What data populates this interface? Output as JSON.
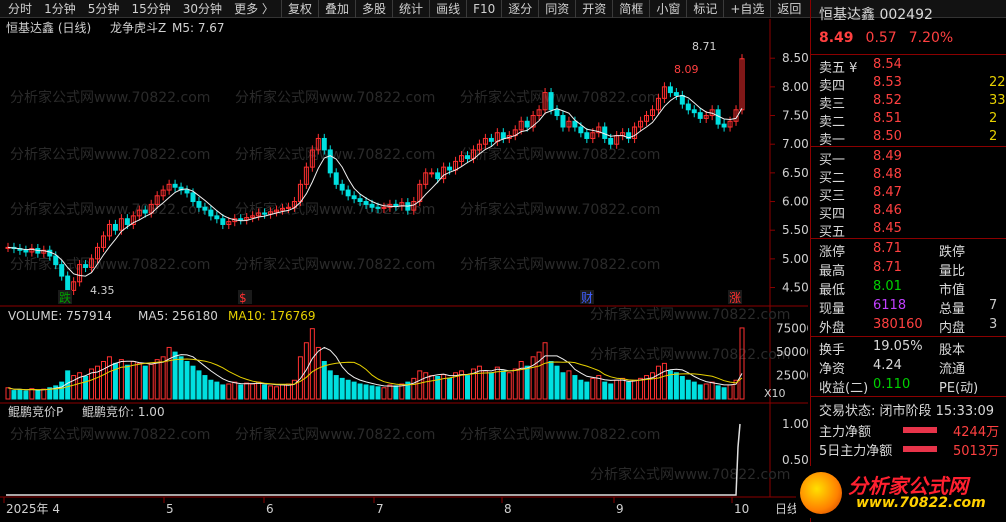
{
  "toolbar": {
    "periods": [
      "分时",
      "1分钟",
      "5分钟",
      "15分钟",
      "30分钟",
      "更多 〉"
    ],
    "buttons": [
      "复权",
      "叠加",
      "多股",
      "统计",
      "画线",
      "F10",
      "逐分",
      "同资",
      "开资",
      "简框",
      "小窗",
      "标记",
      "+自选",
      "返回"
    ]
  },
  "header": {
    "stock": "恒基达鑫 (日线)",
    "indicator": "龙争虎斗Z",
    "ma": "M5: 7.67"
  },
  "watermark": "分析家公式网www.70822.com",
  "price_axis": [
    "8.50",
    "8.00",
    "7.50",
    "7.00",
    "6.50",
    "6.00",
    "5.50",
    "5.00",
    "4.50"
  ],
  "price_labels": {
    "high": "8.71",
    "low": "4.35",
    "peak": "8.09"
  },
  "volume_header": {
    "vol": "VOLUME: 757914",
    "ma5": "MA5: 256180",
    "ma10": "MA10: 176769"
  },
  "volume_axis": [
    "75000",
    "50000",
    "25000"
  ],
  "volume_unit": "X10",
  "bottom_header": {
    "a": "鲲鹏竞价P",
    "b": "鲲鹏竞价: 1.00"
  },
  "bottom_axis": [
    "1.00",
    "0.50"
  ],
  "date_axis": [
    "2025年 4",
    "5",
    "6",
    "7",
    "8",
    "9",
    "10"
  ],
  "period_label": "日线",
  "event_tags": [
    "跌",
    "$",
    "财",
    "涨"
  ],
  "chart_data": {
    "type": "candlestick",
    "close": [
      5.2,
      5.18,
      5.15,
      5.12,
      5.18,
      5.1,
      5.15,
      5.05,
      4.9,
      4.7,
      4.45,
      4.6,
      4.9,
      4.85,
      5.0,
      5.2,
      5.4,
      5.6,
      5.5,
      5.7,
      5.6,
      5.75,
      5.85,
      5.8,
      5.95,
      6.1,
      6.2,
      6.3,
      6.25,
      6.2,
      6.15,
      6.0,
      5.9,
      5.85,
      5.75,
      5.7,
      5.6,
      5.65,
      5.7,
      5.68,
      5.72,
      5.75,
      5.8,
      5.78,
      5.82,
      5.85,
      5.88,
      5.9,
      6.0,
      6.3,
      6.6,
      6.9,
      7.1,
      6.9,
      6.5,
      6.3,
      6.2,
      6.1,
      6.05,
      6.0,
      5.95,
      5.9,
      5.88,
      5.9,
      5.95,
      5.92,
      5.98,
      5.85,
      6.0,
      6.3,
      6.5,
      6.5,
      6.4,
      6.6,
      6.55,
      6.7,
      6.8,
      6.75,
      6.9,
      7.0,
      7.1,
      7.05,
      7.2,
      7.1,
      7.15,
      7.25,
      7.4,
      7.3,
      7.5,
      7.6,
      7.9,
      7.6,
      7.5,
      7.3,
      7.4,
      7.3,
      7.2,
      7.1,
      7.2,
      7.3,
      7.1,
      7.0,
      7.15,
      7.2,
      7.1,
      7.3,
      7.4,
      7.5,
      7.6,
      7.8,
      8.0,
      7.9,
      7.85,
      7.7,
      7.6,
      7.55,
      7.45,
      7.5,
      7.6,
      7.35,
      7.3,
      7.4,
      7.6,
      8.49
    ],
    "volume": [
      12000,
      9000,
      10000,
      8500,
      11000,
      9500,
      10500,
      12000,
      14000,
      18000,
      30000,
      25000,
      28000,
      24000,
      32000,
      35000,
      40000,
      45000,
      38000,
      42000,
      36000,
      40000,
      38000,
      35000,
      37000,
      42000,
      45000,
      55000,
      50000,
      45000,
      40000,
      35000,
      30000,
      25000,
      20000,
      18000,
      15000,
      16000,
      18000,
      15000,
      17000,
      16000,
      18000,
      15000,
      14000,
      13000,
      15000,
      16000,
      20000,
      45000,
      60000,
      75000,
      55000,
      40000,
      30000,
      25000,
      22000,
      20000,
      18000,
      16000,
      15000,
      14000,
      13000,
      12000,
      15000,
      14000,
      16000,
      18000,
      22000,
      30000,
      28000,
      25000,
      24000,
      26000,
      22000,
      28000,
      30000,
      25000,
      32000,
      35000,
      30000,
      28000,
      34000,
      30000,
      28000,
      32000,
      40000,
      35000,
      45000,
      50000,
      60000,
      40000,
      35000,
      28000,
      30000,
      25000,
      20000,
      18000,
      22000,
      25000,
      18000,
      16000,
      20000,
      22000,
      18000,
      20000,
      22000,
      25000,
      28000,
      35000,
      38000,
      30000,
      28000,
      24000,
      20000,
      18000,
      15000,
      16000,
      18000,
      14000,
      12000,
      15000,
      20000,
      75791
    ],
    "ylim": [
      4.3,
      8.8
    ],
    "volume_ylim": [
      0,
      80000
    ]
  },
  "side": {
    "title": "恒基达鑫 002492",
    "price": "8.49",
    "change": "0.57",
    "pct": "7.20%",
    "asks": [
      {
        "k": "卖五 ¥",
        "v": "8.54",
        "q": ""
      },
      {
        "k": "卖四",
        "v": "8.53",
        "q": "22"
      },
      {
        "k": "卖三",
        "v": "8.52",
        "q": "33"
      },
      {
        "k": "卖二",
        "v": "8.51",
        "q": "2"
      },
      {
        "k": "卖一",
        "v": "8.50",
        "q": "2"
      }
    ],
    "bids": [
      {
        "k": "买一",
        "v": "8.49"
      },
      {
        "k": "买二",
        "v": "8.48"
      },
      {
        "k": "买三",
        "v": "8.47"
      },
      {
        "k": "买四",
        "v": "8.46"
      },
      {
        "k": "买五",
        "v": "8.45"
      }
    ],
    "stats": [
      {
        "k": "涨停",
        "v": "8.71",
        "k2": "跌停",
        "v2": ""
      },
      {
        "k": "最高",
        "v": "8.71",
        "k2": "量比",
        "v2": ""
      },
      {
        "k": "最低",
        "v": "8.01",
        "k2": "市值",
        "v2": ""
      },
      {
        "k": "现量",
        "v": "6118",
        "k2": "总量",
        "v2": "7"
      },
      {
        "k": "外盘",
        "v": "380160",
        "k2": "内盘",
        "v2": "3"
      }
    ],
    "stats2": [
      {
        "k": "换手",
        "v": "19.05%",
        "k2": "股本",
        "v2": ""
      },
      {
        "k": "净资",
        "v": "4.24",
        "k2": "流通",
        "v2": ""
      },
      {
        "k": "收益(二)",
        "v": "0.110",
        "k2": "PE(动)",
        "v2": ""
      }
    ],
    "trade_state": "交易状态: 闭市阶段 15:33:09",
    "main_net": {
      "k": "主力净额",
      "v": "4244万"
    },
    "five_net": {
      "k": "5日主力净额",
      "v": "5013万"
    }
  },
  "logo": {
    "t1": "分析家公式网",
    "t2": "www.70822.com"
  }
}
